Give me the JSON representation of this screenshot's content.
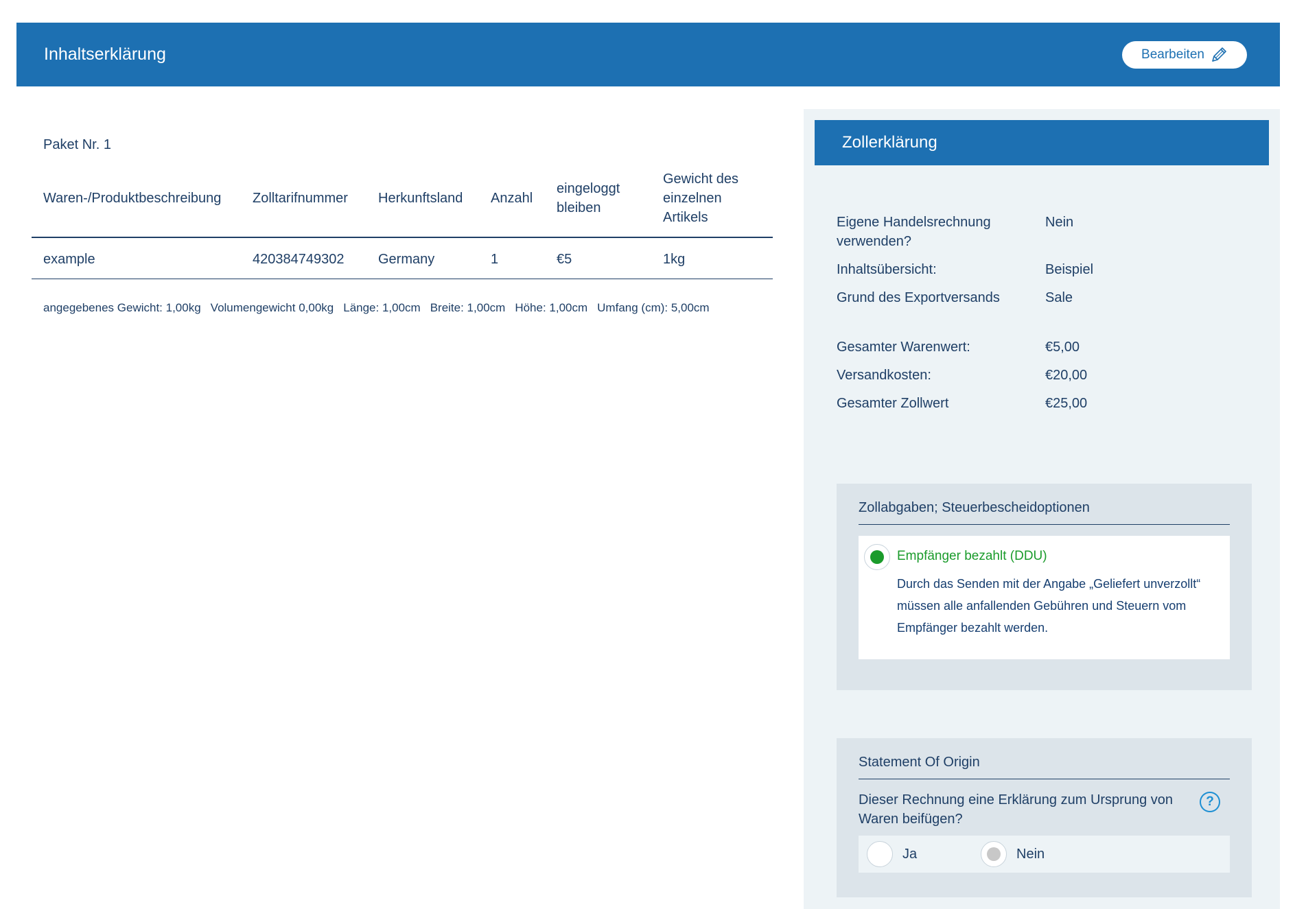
{
  "header": {
    "title": "Inhaltserklärung",
    "edit_label": "Bearbeiten"
  },
  "package": {
    "title": "Paket Nr. 1",
    "columns": [
      "Waren-/Produktbeschreibung",
      "Zolltarifnummer",
      "Herkunftsland",
      "Anzahl",
      "eingeloggt bleiben",
      "Gewicht des einzelnen Artikels"
    ],
    "rows": [
      [
        "example",
        "420384749302",
        "Germany",
        "1",
        "€5",
        "1kg"
      ]
    ],
    "dimensions": [
      "angegebenes Gewicht: 1,00kg",
      "Volumengewicht 0,00kg",
      "Länge: 1,00cm",
      "Breite: 1,00cm",
      "Höhe: 1,00cm",
      "Umfang (cm): 5,00cm"
    ]
  },
  "customs": {
    "title": "Zollerklärung",
    "info": [
      {
        "key": "Eigene Handelsrechnung verwenden?",
        "value": "Nein"
      },
      {
        "key": "Inhaltsübersicht:",
        "value": "Beispiel"
      },
      {
        "key": "Grund des Exportversands",
        "value": "Sale"
      }
    ],
    "totals": [
      {
        "key": "Gesamter Warenwert:",
        "value": "€5,00"
      },
      {
        "key": "Versandkosten:",
        "value": "€20,00"
      },
      {
        "key": "Gesamter Zollwert",
        "value": "€25,00"
      }
    ],
    "duties": {
      "title": "Zollabgaben; Steuerbescheidoptionen",
      "option_label": "Empfänger bezahlt (DDU)",
      "option_desc": "Durch das Senden mit der Angabe „Geliefert unverzollt“ müssen alle anfallenden Gebühren und Steuern vom Empfänger bezahlt werden.",
      "selected": true
    },
    "origin": {
      "title": "Statement Of Origin",
      "question": "Dieser Rechnung eine Erklärung zum Ursprung von Waren beifügen?",
      "help_glyph": "?",
      "yes_label": "Ja",
      "no_label": "Nein"
    }
  },
  "colors": {
    "primary": "#1d70b2",
    "text": "#1f3f66",
    "selected_green": "#1a9b2b",
    "panel_bg": "#edf3f6",
    "box_bg": "#dce4ea"
  }
}
